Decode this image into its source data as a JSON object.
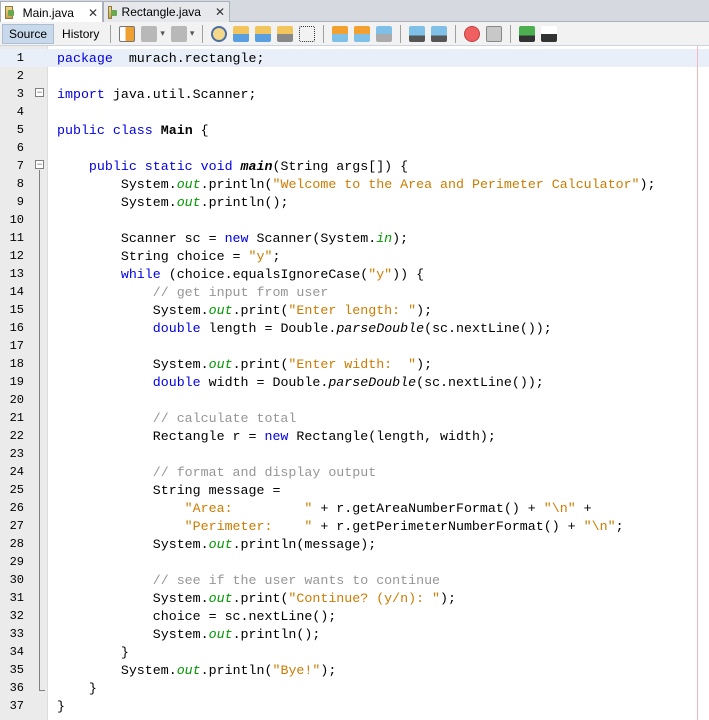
{
  "tabs": [
    {
      "label": "Main.java",
      "active": true
    },
    {
      "label": "Rectangle.java",
      "active": false
    }
  ],
  "toolbar": {
    "source_label": "Source",
    "history_label": "History",
    "icons": [
      "last-edit-icon",
      "back-icon",
      "forward-icon",
      "find-selection-icon",
      "find-previous-icon",
      "find-next-icon",
      "toggle-highlight-icon",
      "toggle-rectangular-selection-icon",
      "previous-bookmark-icon",
      "next-bookmark-icon",
      "toggle-bookmark-icon",
      "shift-left-icon",
      "shift-right-icon",
      "start-macro-icon",
      "stop-macro-icon",
      "comment-icon",
      "uncomment-icon"
    ]
  },
  "colors": {
    "keyword": "#0000e6",
    "string": "#ce7b00",
    "comment": "#969696",
    "field": "#009900"
  },
  "code": [
    {
      "n": "1",
      "t": [
        [
          "kw",
          "package"
        ],
        [
          "",
          "  murach.rectangle;"
        ]
      ]
    },
    {
      "n": "2",
      "t": []
    },
    {
      "n": "3",
      "t": [
        [
          "kw",
          "import"
        ],
        [
          "",
          " java.util.Scanner;"
        ]
      ]
    },
    {
      "n": "4",
      "t": []
    },
    {
      "n": "5",
      "t": [
        [
          "kw",
          "public class"
        ],
        [
          "",
          " "
        ],
        [
          "b",
          "Main"
        ],
        [
          "",
          " {"
        ]
      ]
    },
    {
      "n": "6",
      "t": []
    },
    {
      "n": "7",
      "t": [
        [
          "",
          "    "
        ],
        [
          "kw",
          "public static void"
        ],
        [
          "",
          " "
        ],
        [
          "bi",
          "main"
        ],
        [
          "",
          "(String args[]) {"
        ]
      ]
    },
    {
      "n": "8",
      "t": [
        [
          "",
          "        System."
        ],
        [
          "out",
          "out"
        ],
        [
          "",
          ".println("
        ],
        [
          "str",
          "\"Welcome to the Area and Perimeter Calculator\""
        ],
        [
          "",
          ");"
        ]
      ]
    },
    {
      "n": "9",
      "t": [
        [
          "",
          "        System."
        ],
        [
          "out",
          "out"
        ],
        [
          "",
          ".println();"
        ]
      ]
    },
    {
      "n": "10",
      "t": []
    },
    {
      "n": "11",
      "t": [
        [
          "",
          "        Scanner sc = "
        ],
        [
          "kw",
          "new"
        ],
        [
          "",
          " Scanner(System."
        ],
        [
          "out",
          "in"
        ],
        [
          "",
          ");"
        ]
      ]
    },
    {
      "n": "12",
      "t": [
        [
          "",
          "        String choice = "
        ],
        [
          "str",
          "\"y\""
        ],
        [
          "",
          ";"
        ]
      ]
    },
    {
      "n": "13",
      "t": [
        [
          "",
          "        "
        ],
        [
          "kw",
          "while"
        ],
        [
          "",
          " (choice.equalsIgnoreCase("
        ],
        [
          "str",
          "\"y\""
        ],
        [
          "",
          ")) {"
        ]
      ]
    },
    {
      "n": "14",
      "t": [
        [
          "",
          "            "
        ],
        [
          "cm",
          "// get input from user"
        ]
      ]
    },
    {
      "n": "15",
      "t": [
        [
          "",
          "            System."
        ],
        [
          "out",
          "out"
        ],
        [
          "",
          ".print("
        ],
        [
          "str",
          "\"Enter length: \""
        ],
        [
          "",
          ");"
        ]
      ]
    },
    {
      "n": "16",
      "t": [
        [
          "",
          "            "
        ],
        [
          "kw",
          "double"
        ],
        [
          "",
          " length = Double."
        ],
        [
          "it",
          "parseDouble"
        ],
        [
          "",
          "(sc.nextLine());"
        ]
      ]
    },
    {
      "n": "17",
      "t": []
    },
    {
      "n": "18",
      "t": [
        [
          "",
          "            System."
        ],
        [
          "out",
          "out"
        ],
        [
          "",
          ".print("
        ],
        [
          "str",
          "\"Enter width:  \""
        ],
        [
          "",
          ");"
        ]
      ]
    },
    {
      "n": "19",
      "t": [
        [
          "",
          "            "
        ],
        [
          "kw",
          "double"
        ],
        [
          "",
          " width = Double."
        ],
        [
          "it",
          "parseDouble"
        ],
        [
          "",
          "(sc.nextLine());"
        ]
      ]
    },
    {
      "n": "20",
      "t": []
    },
    {
      "n": "21",
      "t": [
        [
          "",
          "            "
        ],
        [
          "cm",
          "// calculate total"
        ]
      ]
    },
    {
      "n": "22",
      "t": [
        [
          "",
          "            Rectangle r = "
        ],
        [
          "kw",
          "new"
        ],
        [
          "",
          " Rectangle(length, width);"
        ]
      ]
    },
    {
      "n": "23",
      "t": []
    },
    {
      "n": "24",
      "t": [
        [
          "",
          "            "
        ],
        [
          "cm",
          "// format and display output"
        ]
      ]
    },
    {
      "n": "25",
      "t": [
        [
          "",
          "            String message ="
        ]
      ]
    },
    {
      "n": "26",
      "t": [
        [
          "",
          "                "
        ],
        [
          "str",
          "\"Area:         \""
        ],
        [
          "",
          " + r.getAreaNumberFormat() + "
        ],
        [
          "str",
          "\"\\n\""
        ],
        [
          "",
          " +"
        ]
      ]
    },
    {
      "n": "27",
      "t": [
        [
          "",
          "                "
        ],
        [
          "str",
          "\"Perimeter:    \""
        ],
        [
          "",
          " + r.getPerimeterNumberFormat() + "
        ],
        [
          "str",
          "\"\\n\""
        ],
        [
          "",
          ";"
        ]
      ]
    },
    {
      "n": "28",
      "t": [
        [
          "",
          "            System."
        ],
        [
          "out",
          "out"
        ],
        [
          "",
          ".println(message);"
        ]
      ]
    },
    {
      "n": "29",
      "t": []
    },
    {
      "n": "30",
      "t": [
        [
          "",
          "            "
        ],
        [
          "cm",
          "// see if the user wants to continue"
        ]
      ]
    },
    {
      "n": "31",
      "t": [
        [
          "",
          "            System."
        ],
        [
          "out",
          "out"
        ],
        [
          "",
          ".print("
        ],
        [
          "str",
          "\"Continue? (y/n): \""
        ],
        [
          "",
          ");"
        ]
      ]
    },
    {
      "n": "32",
      "t": [
        [
          "",
          "            choice = sc.nextLine();"
        ]
      ]
    },
    {
      "n": "33",
      "t": [
        [
          "",
          "            System."
        ],
        [
          "out",
          "out"
        ],
        [
          "",
          ".println();"
        ]
      ]
    },
    {
      "n": "34",
      "t": [
        [
          "",
          "        }"
        ]
      ]
    },
    {
      "n": "35",
      "t": [
        [
          "",
          "        System."
        ],
        [
          "out",
          "out"
        ],
        [
          "",
          ".println("
        ],
        [
          "str",
          "\"Bye!\""
        ],
        [
          "",
          ");"
        ]
      ]
    },
    {
      "n": "36",
      "t": [
        [
          "",
          "    }"
        ]
      ]
    },
    {
      "n": "37",
      "t": [
        [
          "",
          "}"
        ]
      ]
    }
  ]
}
